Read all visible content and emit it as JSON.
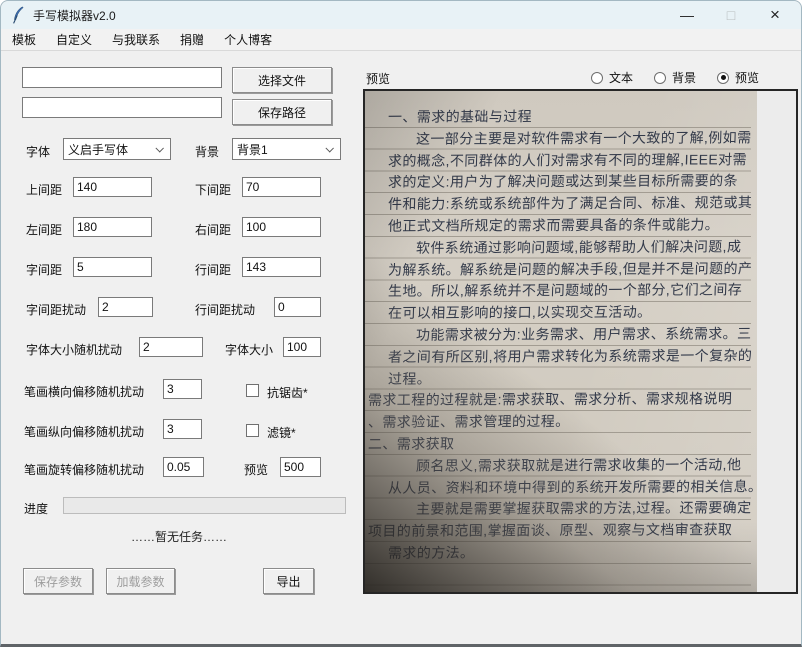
{
  "window": {
    "title": "手写模拟器v2.0",
    "controls": {
      "minimize": "—",
      "maximize": "□",
      "close": "×"
    }
  },
  "menu": {
    "items": [
      {
        "label": "模板"
      },
      {
        "label": "自定义"
      },
      {
        "label": "与我联系"
      },
      {
        "label": "捐赠"
      },
      {
        "label": "个人博客"
      }
    ]
  },
  "file_section": {
    "file_input_value": "",
    "choose_file_button": "选择文件",
    "save_path_input_value": "",
    "save_path_button": "保存路径"
  },
  "selectors": {
    "font_label": "字体",
    "font_value": "义启手写体",
    "background_label": "背景",
    "background_value": "背景1"
  },
  "params": {
    "top": {
      "label": "上间距",
      "value": "140"
    },
    "bottom": {
      "label": "下间距",
      "value": "70"
    },
    "left": {
      "label": "左间距",
      "value": "180"
    },
    "right": {
      "label": "右间距",
      "value": "100"
    },
    "char_spacing": {
      "label": "字间距",
      "value": "5"
    },
    "line_spacing": {
      "label": "行间距",
      "value": "143"
    },
    "char_spacing_jitter": {
      "label": "字间距扰动",
      "value": "2"
    },
    "line_spacing_jitter": {
      "label": "行间距扰动",
      "value": "0"
    },
    "font_size_jitter": {
      "label": "字体大小随机扰动",
      "value": "2"
    },
    "font_size": {
      "label": "字体大小",
      "value": "100"
    },
    "stroke_h_jitter": {
      "label": "笔画横向偏移随机扰动",
      "value": "3"
    },
    "stroke_v_jitter": {
      "label": "笔画纵向偏移随机扰动",
      "value": "3"
    },
    "stroke_rot_jitter": {
      "label": "笔画旋转偏移随机扰动",
      "value": "0.05"
    },
    "preview_count": {
      "label": "预览",
      "value": "500"
    }
  },
  "checkboxes": {
    "antialias": {
      "label": "抗锯齿*",
      "checked": false
    },
    "filter": {
      "label": "滤镜*",
      "checked": false
    }
  },
  "progress": {
    "label": "进度",
    "percent": 0,
    "status": "……暂无任务……"
  },
  "actions": {
    "save_params": "保存参数",
    "load_params": "加载参数",
    "export": "导出"
  },
  "preview_panel": {
    "label": "预览",
    "modes": [
      {
        "label": "文本",
        "selected": false
      },
      {
        "label": "背景",
        "selected": false
      },
      {
        "label": "预览",
        "selected": true
      }
    ],
    "handwriting_lines": [
      {
        "text": "一、需求的基础与过程",
        "indent": "body"
      },
      {
        "text": "这一部分主要是对软件需求有一个大致的了解,例如需",
        "indent": "first"
      },
      {
        "text": "求的概念,不同群体的人们对需求有不同的理解,IEEE对需",
        "indent": "body"
      },
      {
        "text": "求的定义:用户为了解决问题或达到某些目标所需要的条",
        "indent": "body"
      },
      {
        "text": "件和能力:系统或系统部件为了满足合同、标准、规范或其",
        "indent": "body"
      },
      {
        "text": "他正式文档所规定的需求而需要具备的条件或能力。",
        "indent": "body"
      },
      {
        "text": "软件系统通过影响问题域,能够帮助人们解决问题,成",
        "indent": "first"
      },
      {
        "text": "为解系统。解系统是问题的解决手段,但是并不是问题的产",
        "indent": "body"
      },
      {
        "text": "生地。所以,解系统并不是问题域的一个部分,它们之间存",
        "indent": "body"
      },
      {
        "text": "在可以相互影响的接口,以实现交互活动。",
        "indent": "body"
      },
      {
        "text": "功能需求被分为:业务需求、用户需求、系统需求。三",
        "indent": "first"
      },
      {
        "text": "者之间有所区别,将用户需求转化为系统需求是一个复杂的",
        "indent": "body"
      },
      {
        "text": "过程。",
        "indent": "body"
      },
      {
        "text": "需求工程的过程就是:需求获取、需求分析、需求规格说明",
        "indent": "flush"
      },
      {
        "text": "、需求验证、需求管理的过程。",
        "indent": "flush"
      },
      {
        "text": "二、需求获取",
        "indent": "flush"
      },
      {
        "text": "顾名思义,需求获取就是进行需求收集的一个活动,他",
        "indent": "first"
      },
      {
        "text": "从人员、资料和环境中得到的系统开发所需要的相关信息。",
        "indent": "body"
      },
      {
        "text": "主要就是需要掌握获取需求的方法,过程。还需要确定",
        "indent": "first"
      },
      {
        "text": "项目的前景和范围,掌握面谈、原型、观察与文档审查获取",
        "indent": "flush"
      },
      {
        "text": "需求的方法。",
        "indent": "body"
      }
    ]
  },
  "colors": {
    "titlebar": "#e8f2f6",
    "window_bg": "#f0f0f0",
    "canvas_bg": "#ececec",
    "paper": "#d2ccc1",
    "ink": "#333a4a",
    "canvas_border": "#262626"
  }
}
